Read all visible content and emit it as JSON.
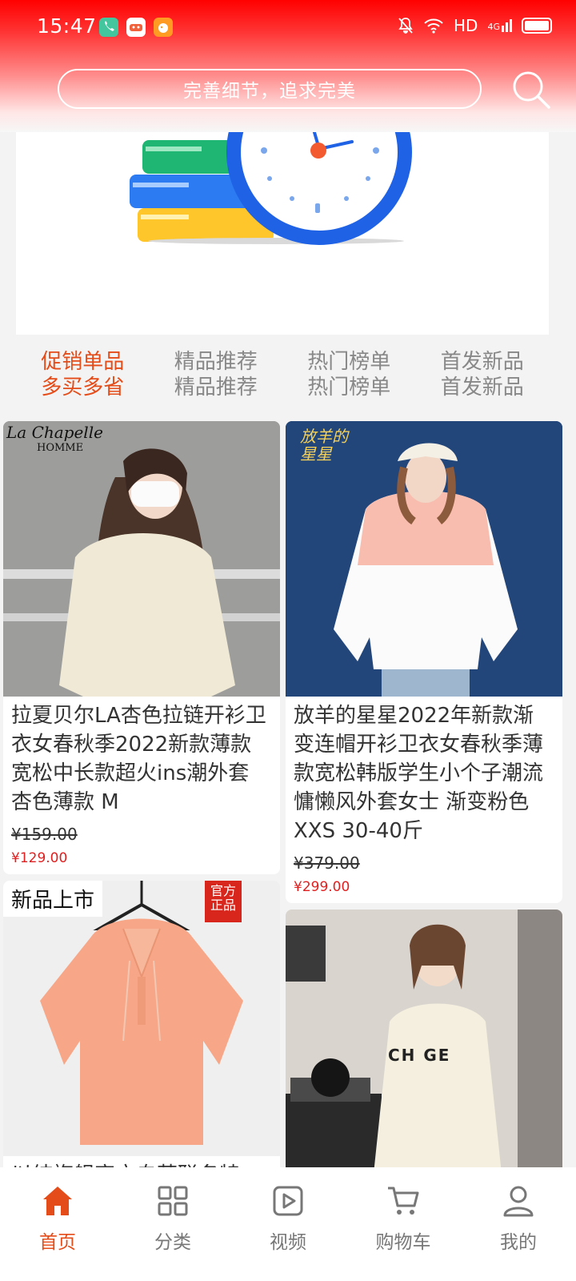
{
  "status_bar": {
    "time": "15:47",
    "network": "HD",
    "signal": "4G"
  },
  "search": {
    "placeholder": "完善细节，追求完美"
  },
  "tabs": [
    {
      "line1": "促销单品",
      "line2": "多买多省",
      "active": true
    },
    {
      "line1": "精品推荐",
      "line2": "精品推荐",
      "active": false
    },
    {
      "line1": "热门榜单",
      "line2": "热门榜单",
      "active": false
    },
    {
      "line1": "首发新品",
      "line2": "首发新品",
      "active": false
    }
  ],
  "products": [
    {
      "brand_overlay": "La Chapelle",
      "brand_sub": "HOMME",
      "title": "拉夏贝尔LA杏色拉链开衫卫衣女春秋季2022新款薄款宽松中长款超火ins潮外套 杏色薄款 M",
      "price_old": "¥159.00",
      "price_new": "¥129.00"
    },
    {
      "brand_overlay": "放羊的星星",
      "title": "放羊的星星2022年新款渐变连帽开衫卫衣女春秋季薄款宽松韩版学生小个子潮流慵懒风外套女士 渐变粉色 XXS 30-40斤",
      "price_old": "¥379.00",
      "price_new": "¥299.00"
    },
    {
      "overlay_left": "新品上市",
      "overlay_right": "官方正品",
      "title": "以纯旗舰官方自营联名特"
    },
    {
      "overlay_text": "CH GE"
    }
  ],
  "bottom_nav": [
    {
      "label": "首页",
      "icon": "home-icon",
      "active": true
    },
    {
      "label": "分类",
      "icon": "grid-icon",
      "active": false
    },
    {
      "label": "视频",
      "icon": "video-icon",
      "active": false
    },
    {
      "label": "购物车",
      "icon": "cart-icon",
      "active": false
    },
    {
      "label": "我的",
      "icon": "profile-icon",
      "active": false
    }
  ],
  "colors": {
    "accent": "#e44d1a",
    "header_red": "#ff0000",
    "price_red": "#e02020"
  }
}
